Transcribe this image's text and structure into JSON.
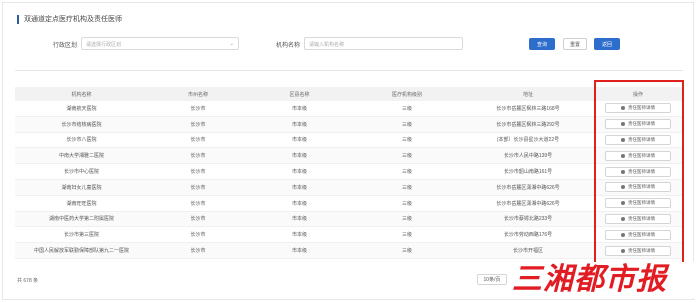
{
  "page": {
    "title": "双通道定点医疗机构及责任医师"
  },
  "filters": {
    "region_label": "行政区划",
    "region_placeholder": "请选择行政区划",
    "name_label": "机构名称",
    "name_placeholder": "请输入机构名称",
    "query_button": "查询",
    "reset_button": "重置",
    "back_button": "返回"
  },
  "table": {
    "columns": [
      "机构名称",
      "市州名称",
      "区县名称",
      "医疗机构级别",
      "地址",
      "操作"
    ],
    "rows": [
      [
        "湖南航天医院",
        "长沙市",
        "市本级",
        "三级",
        "长沙市岳麓区枫林三路168号",
        "责任医师详情"
      ],
      [
        "长沙市结核病医院",
        "长沙市",
        "市本级",
        "三级",
        "长沙市岳麓区枫林三路292号",
        "责任医师详情"
      ],
      [
        "长沙市八医院",
        "长沙市",
        "市本级",
        "三级",
        "(本部）长沙县星沙大道22号",
        "责任医师详情"
      ],
      [
        "中南大学湘雅二医院",
        "长沙市",
        "市本级",
        "三级",
        "长沙市人民中路139号",
        "责任医师详情"
      ],
      [
        "长沙市中心医院",
        "长沙市",
        "市本级",
        "三级",
        "长沙市韶山南路161号",
        "责任医师详情"
      ],
      [
        "湖南妇女儿童医院",
        "长沙市",
        "市本级",
        "三级",
        "长沙市岳麓区潇湘中路626号",
        "责任医师详情"
      ],
      [
        "湖南旺旺医院",
        "长沙市",
        "市本级",
        "三级",
        "长沙市岳麓区潇湘中路626号",
        "责任医师详情"
      ],
      [
        "湖南中医药大学第二附属医院",
        "长沙市",
        "市本级",
        "三级",
        "长沙市蔡锷北路233号",
        "责任医师详情"
      ],
      [
        "长沙市第三医院",
        "长沙市",
        "市本级",
        "三级",
        "长沙市劳动西路176号",
        "责任医师详情"
      ],
      [
        "中国人民解放军联勤保障部队第九二一医院",
        "长沙市",
        "市本级",
        "三级",
        "长沙市开福区",
        "责任医师详情"
      ]
    ]
  },
  "footer": {
    "total": "共 678 条",
    "page_size": "10条/页"
  },
  "watermark": {
    "text": "三湘都市报"
  },
  "colors": {
    "accent": "#2d6dcc",
    "highlight_box": "#e0201b",
    "watermark": "#e21c23"
  },
  "icons": {
    "op_button": "info-circle-icon",
    "select": "chevron-down-icon"
  }
}
